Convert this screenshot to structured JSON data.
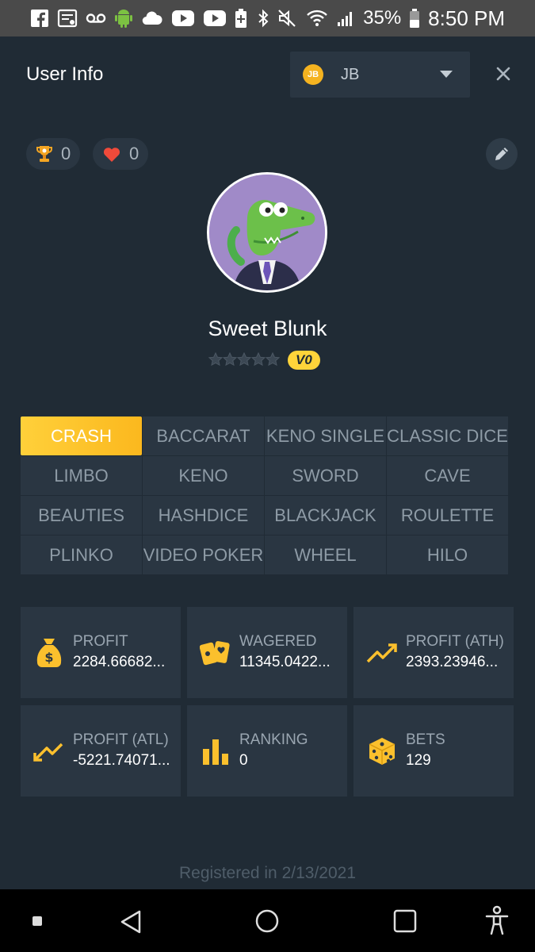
{
  "status_bar": {
    "battery": "35%",
    "time": "8:50 PM",
    "icons_left": [
      "facebook-icon",
      "news-icon",
      "voicemail-icon",
      "android-icon",
      "cloud-icon",
      "youtube-icon",
      "youtube-icon",
      "battery-add-icon"
    ],
    "icons_right": [
      "bluetooth-icon",
      "mute-icon",
      "wifi-icon",
      "signal-icon",
      "battery-icon"
    ]
  },
  "header": {
    "title": "User Info",
    "currency": {
      "coin": "JB",
      "code": "JB"
    }
  },
  "badges": {
    "trophy_count": "0",
    "likes_count": "0"
  },
  "profile": {
    "username": "Sweet Blunk",
    "vip_level": "V0"
  },
  "games": {
    "tabs": [
      "CRASH",
      "BACCARAT",
      "KENO SINGLE",
      "CLASSIC DICE",
      "LIMBO",
      "KENO",
      "SWORD",
      "CAVE",
      "BEAUTIES",
      "HASHDICE",
      "BLACKJACK",
      "ROULETTE",
      "PLINKO",
      "VIDEO POKER",
      "WHEEL",
      "HILO"
    ],
    "active": "CRASH"
  },
  "stats": [
    {
      "label": "PROFIT",
      "value": "2284.66682...",
      "icon": "money-bag-icon"
    },
    {
      "label": "WAGERED",
      "value": "11345.0422...",
      "icon": "cards-icon"
    },
    {
      "label": "PROFIT (ATH)",
      "value": "2393.23946...",
      "icon": "trend-up-icon"
    },
    {
      "label": "PROFIT (ATL)",
      "value": "-5221.74071...",
      "icon": "trend-down-icon"
    },
    {
      "label": "RANKING",
      "value": "0",
      "icon": "bar-chart-icon"
    },
    {
      "label": "BETS",
      "value": "129",
      "icon": "dice-icon"
    }
  ],
  "footer": {
    "registered": "Registered in 2/13/2021"
  },
  "colors": {
    "background": "#202b35",
    "card": "#2a3642",
    "accent": "#fbc02d"
  }
}
